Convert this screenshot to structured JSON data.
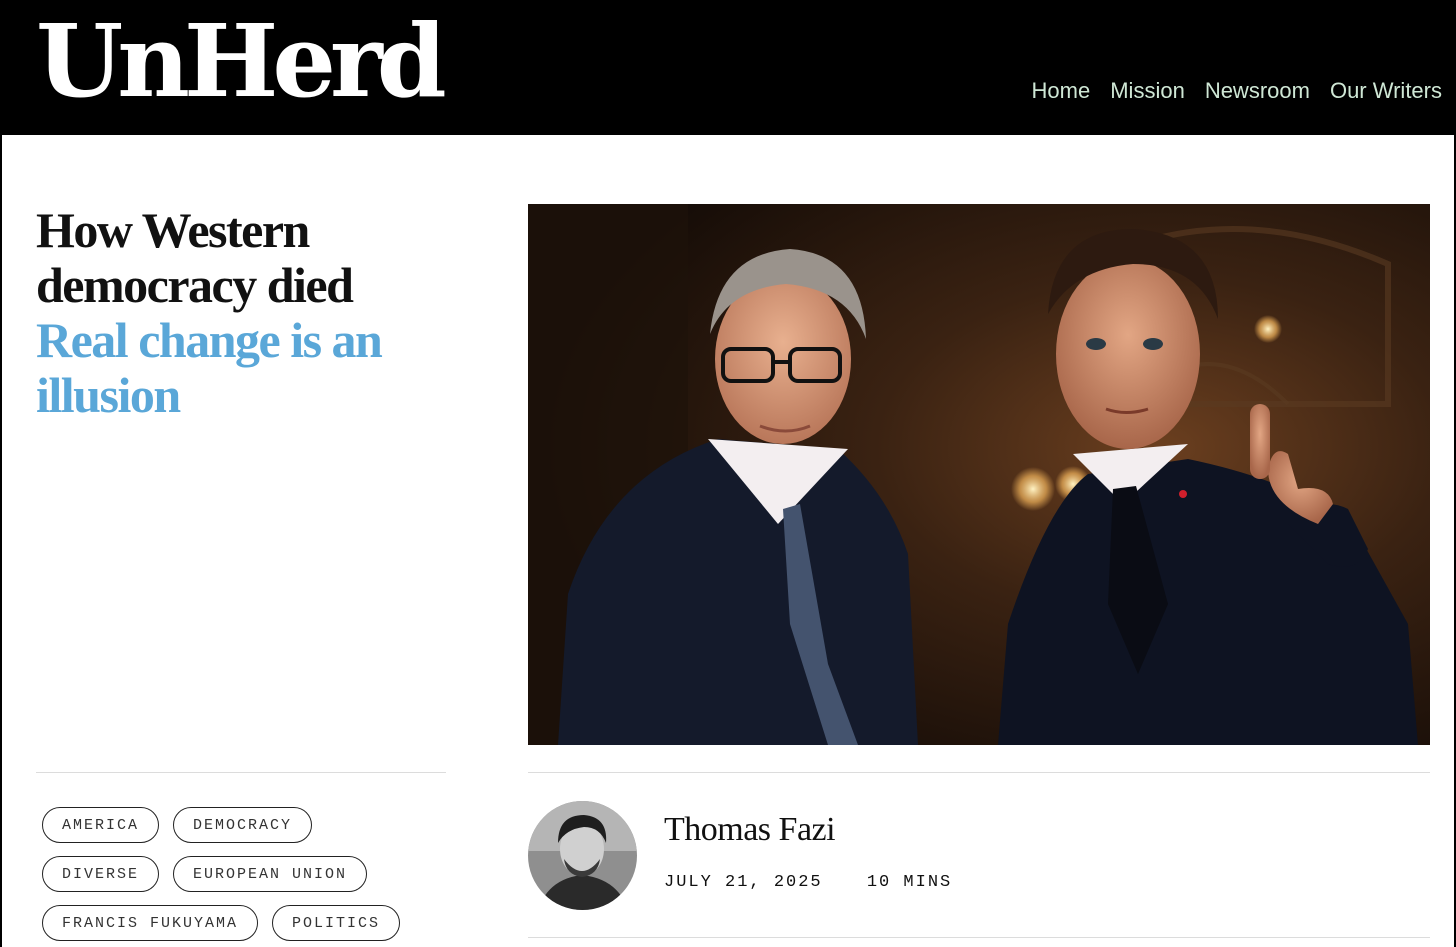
{
  "header": {
    "logo": "UnHerd",
    "nav": [
      {
        "label": "Home"
      },
      {
        "label": "Mission"
      },
      {
        "label": "Newsroom"
      },
      {
        "label": "Our Writers"
      }
    ],
    "background": "#000000",
    "nav_color": "#cfe7d5"
  },
  "article": {
    "title": "How Western democracy died",
    "subtitle": "Real change is an illusion",
    "subtitle_color": "#5aa7d8",
    "hero_icon": "photo-image"
  },
  "tags": [
    [
      "AMERICA",
      "DEMOCRACY"
    ],
    [
      "DIVERSE",
      "EUROPEAN UNION"
    ],
    [
      "FRANCIS FUKUYAMA",
      "POLITICS"
    ]
  ],
  "author": {
    "name": "Thomas Fazi",
    "date": "JULY 21, 2025",
    "read_time": "10 MINS",
    "avatar_icon": "avatar-photo"
  }
}
